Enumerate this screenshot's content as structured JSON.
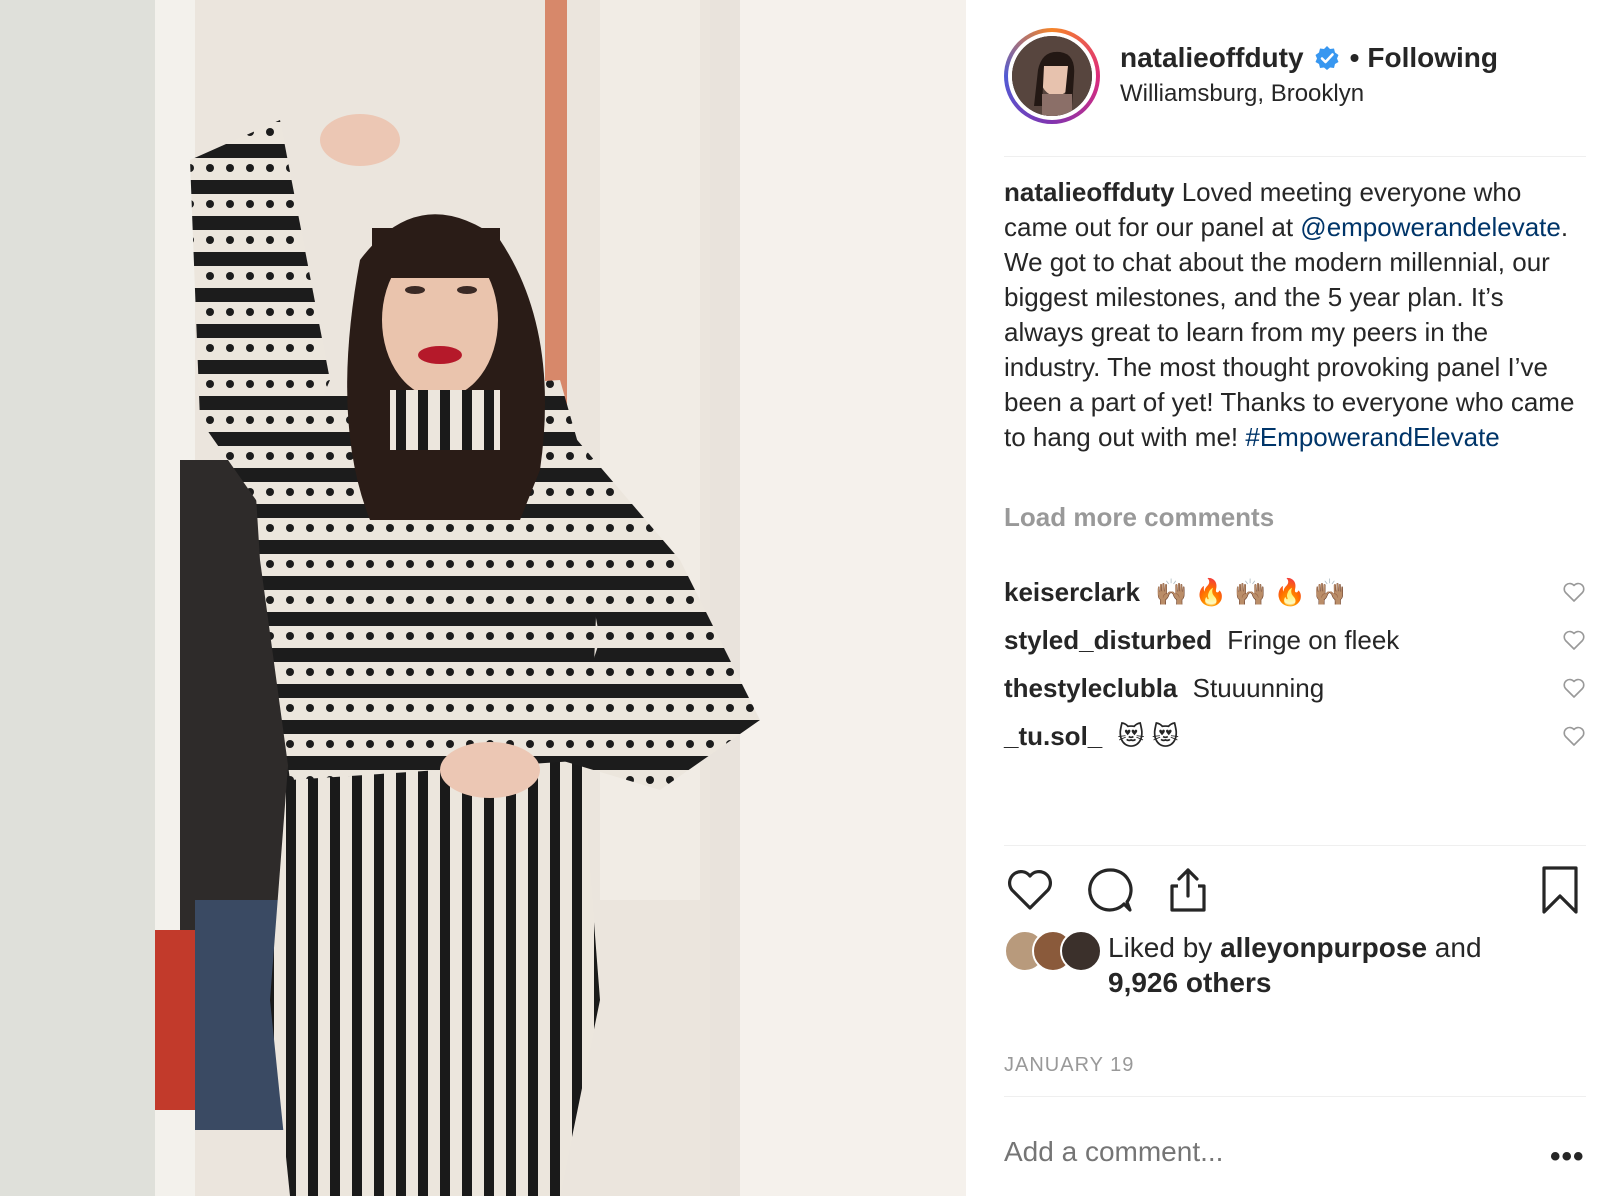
{
  "post": {
    "username": "natalieoffduty",
    "verified_icon": "verified-badge-icon",
    "separator": "•",
    "follow_status": "Following",
    "location": "Williamsburg, Brooklyn",
    "caption": {
      "username": "natalieoffduty",
      "text_1": "Loved meeting everyone who came out for our panel at",
      "mention": "@empowerandelevate",
      "text_2": ". We got to chat about the modern millennial, our biggest milestones, and the 5 year plan. It’s always great to learn from my peers in the industry. The most thought provoking panel I’ve been a part of yet! Thanks to everyone who came to hang out with me!",
      "hashtag": "#EmpowerandElevate"
    },
    "load_more": "Load more comments",
    "comments": [
      {
        "username": "keiserclark",
        "text": "🙌🏽 🔥 🙌🏽 🔥 🙌🏽"
      },
      {
        "username": "styled_disturbed",
        "text": "Fringe on fleek"
      },
      {
        "username": "thestyleclubla",
        "text": "Stuuunning"
      },
      {
        "username": "_tu.sol_",
        "text": "😻 😻"
      }
    ],
    "likes": {
      "prefix": "Liked by",
      "user": "alleyonpurpose",
      "and": "and",
      "others": "9,926 others"
    },
    "date": "JANUARY 19",
    "add_comment_placeholder": "Add a comment...",
    "more_options": "•••"
  },
  "colors": {
    "text": "#262626",
    "muted": "#999999",
    "link": "#003569",
    "verified": "#3897f0",
    "divider": "#efefef"
  }
}
